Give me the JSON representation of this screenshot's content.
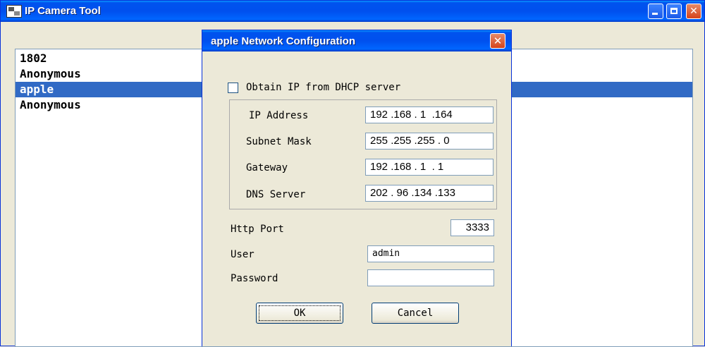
{
  "main_window": {
    "title": "IP Camera Tool",
    "list_items": [
      "1802",
      "Anonymous",
      "apple",
      "Anonymous"
    ],
    "selected_index": 2
  },
  "dialog": {
    "title": "apple Network Configuration",
    "dhcp_label": "Obtain IP from DHCP server",
    "dhcp_checked": false,
    "ip_address_label": "IP Address",
    "ip_address_value": "192 .168 . 1  .164",
    "subnet_mask_label": "Subnet Mask",
    "subnet_mask_value": "255 .255 .255 . 0",
    "gateway_label": "Gateway",
    "gateway_value": "192 .168 . 1  . 1",
    "dns_server_label": "DNS Server",
    "dns_server_value": "202 . 96 .134 .133",
    "http_port_label": "Http Port",
    "http_port_value": "3333",
    "user_label": "User",
    "user_value": "admin",
    "password_label": "Password",
    "password_value": "",
    "ok_label": "OK",
    "cancel_label": "Cancel"
  },
  "colors": {
    "titlebar": "#0054e3",
    "selection": "#316ac5",
    "window_bg": "#ece9d8"
  }
}
